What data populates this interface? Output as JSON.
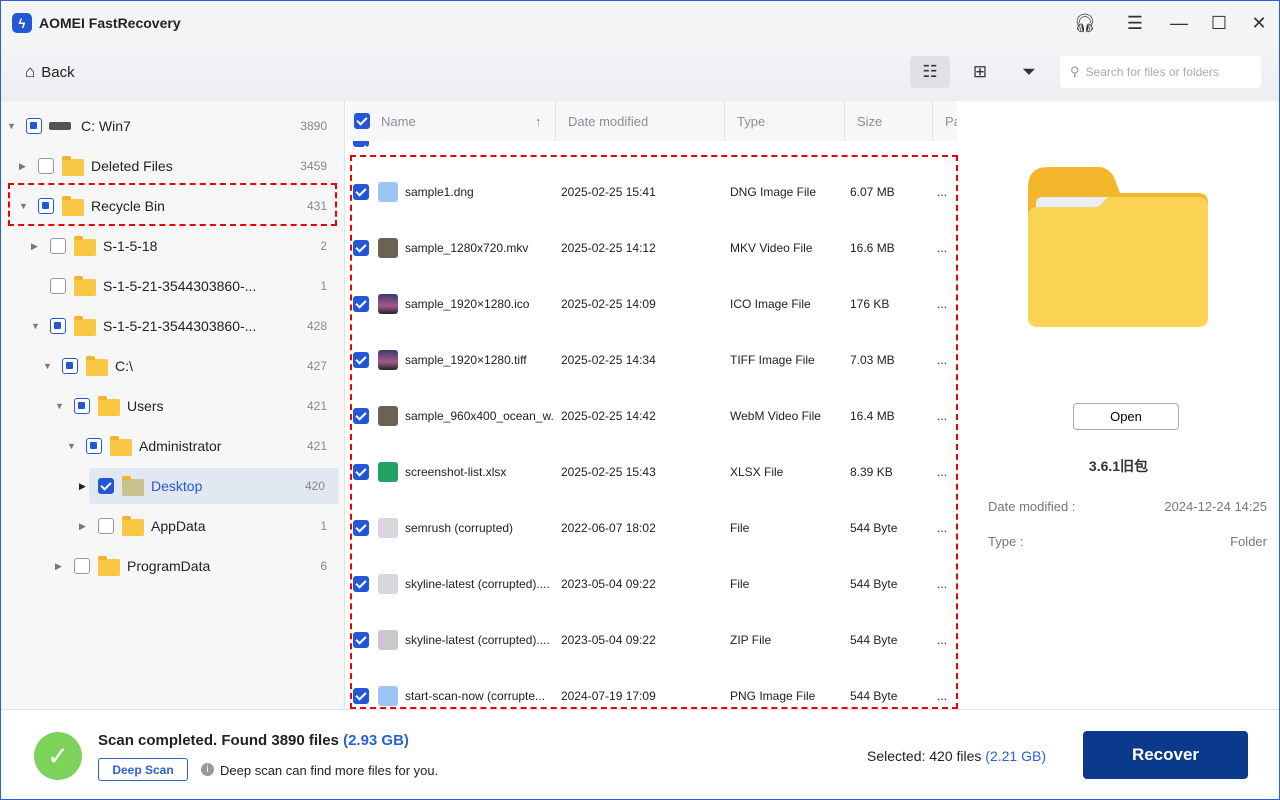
{
  "app": {
    "title": "AOMEI FastRecovery"
  },
  "toolbar": {
    "back_label": "Back",
    "search_placeholder": "Search for files or folders"
  },
  "tree": [
    {
      "label": "C: Win7",
      "count": "3890",
      "level": 0,
      "arrow": "down",
      "check": "partial",
      "icon": "drive"
    },
    {
      "label": "Deleted Files",
      "count": "3459",
      "level": 1,
      "arrow": "right",
      "check": "unchecked",
      "icon": "trash-folder"
    },
    {
      "label": "Recycle Bin",
      "count": "431",
      "level": 1,
      "arrow": "down",
      "check": "partial",
      "icon": "recycle-folder"
    },
    {
      "label": "S-1-5-18",
      "count": "2",
      "level": 2,
      "arrow": "right",
      "check": "unchecked",
      "icon": "folder"
    },
    {
      "label": "S-1-5-21-3544303860-...",
      "count": "1",
      "level": 2,
      "arrow": "",
      "check": "unchecked",
      "icon": "folder"
    },
    {
      "label": "S-1-5-21-3544303860-...",
      "count": "428",
      "level": 2,
      "arrow": "down",
      "check": "partial",
      "icon": "folder"
    },
    {
      "label": "C:\\",
      "count": "427",
      "level": 3,
      "arrow": "down",
      "check": "partial",
      "icon": "folder"
    },
    {
      "label": "Users",
      "count": "421",
      "level": 4,
      "arrow": "down",
      "check": "partial",
      "icon": "folder"
    },
    {
      "label": "Administrator",
      "count": "421",
      "level": 5,
      "arrow": "down",
      "check": "partial",
      "icon": "folder"
    },
    {
      "label": "Desktop",
      "count": "420",
      "level": 6,
      "arrow": "right",
      "check": "checked",
      "icon": "folder",
      "selected": true
    },
    {
      "label": "AppData",
      "count": "1",
      "level": 6,
      "arrow": "right",
      "check": "unchecked",
      "icon": "folder"
    },
    {
      "label": "ProgramData",
      "count": "6",
      "level": 4,
      "arrow": "right",
      "check": "unchecked",
      "icon": "folder"
    }
  ],
  "columns": {
    "name": "Name",
    "date": "Date modified",
    "type": "Type",
    "size": "Size",
    "path": "Pa"
  },
  "files": [
    {
      "name": "sample1.dng",
      "date": "2025-02-25 15:41",
      "type": "DNG Image File",
      "size": "6.07 MB",
      "more": "...",
      "icon": "image"
    },
    {
      "name": "sample_1280x720.mkv",
      "date": "2025-02-25 14:12",
      "type": "MKV Video File",
      "size": "16.6 MB",
      "more": "...",
      "icon": "video"
    },
    {
      "name": "sample_1920×1280.ico",
      "date": "2025-02-25 14:09",
      "type": "ICO Image File",
      "size": "176 KB",
      "more": "...",
      "icon": "photo"
    },
    {
      "name": "sample_1920×1280.tiff",
      "date": "2025-02-25 14:34",
      "type": "TIFF Image File",
      "size": "7.03 MB",
      "more": "...",
      "icon": "photo"
    },
    {
      "name": "sample_960x400_ocean_w...",
      "date": "2025-02-25 14:42",
      "type": "WebM Video File",
      "size": "16.4 MB",
      "more": "...",
      "icon": "video"
    },
    {
      "name": "screenshot-list.xlsx",
      "date": "2025-02-25 15:43",
      "type": "XLSX File",
      "size": "8.39 KB",
      "more": "...",
      "icon": "excel"
    },
    {
      "name": "semrush (corrupted)",
      "date": "2022-06-07 18:02",
      "type": "File",
      "size": "544 Byte",
      "more": "...",
      "icon": "unknown"
    },
    {
      "name": "skyline-latest (corrupted)....",
      "date": "2023-05-04 09:22",
      "type": "File",
      "size": "544 Byte",
      "more": "...",
      "icon": "unknown"
    },
    {
      "name": "skyline-latest (corrupted)....",
      "date": "2023-05-04 09:22",
      "type": "ZIP File",
      "size": "544 Byte",
      "more": "...",
      "icon": "zip"
    },
    {
      "name": "start-scan-now (corrupte...",
      "date": "2024-07-19 17:09",
      "type": "PNG Image File",
      "size": "544 Byte",
      "more": "...",
      "icon": "image"
    }
  ],
  "preview": {
    "open_label": "Open",
    "name": "3.6.1旧包",
    "date_label": "Date modified :",
    "date_value": "2024-12-24 14:25",
    "type_label": "Type :",
    "type_value": "Folder"
  },
  "status": {
    "text": "Scan completed. Found 3890 files",
    "size": "(2.93 GB)",
    "deep_scan_label": "Deep Scan",
    "hint": "Deep scan can find more files for you.",
    "selected_text": "Selected: 420 files",
    "selected_size": "(2.21 GB)",
    "recover_label": "Recover"
  },
  "colors": {
    "accent": "#2457d6",
    "recover": "#0b3a8c",
    "success": "#7dd35a",
    "highlight": "#ee0000"
  }
}
